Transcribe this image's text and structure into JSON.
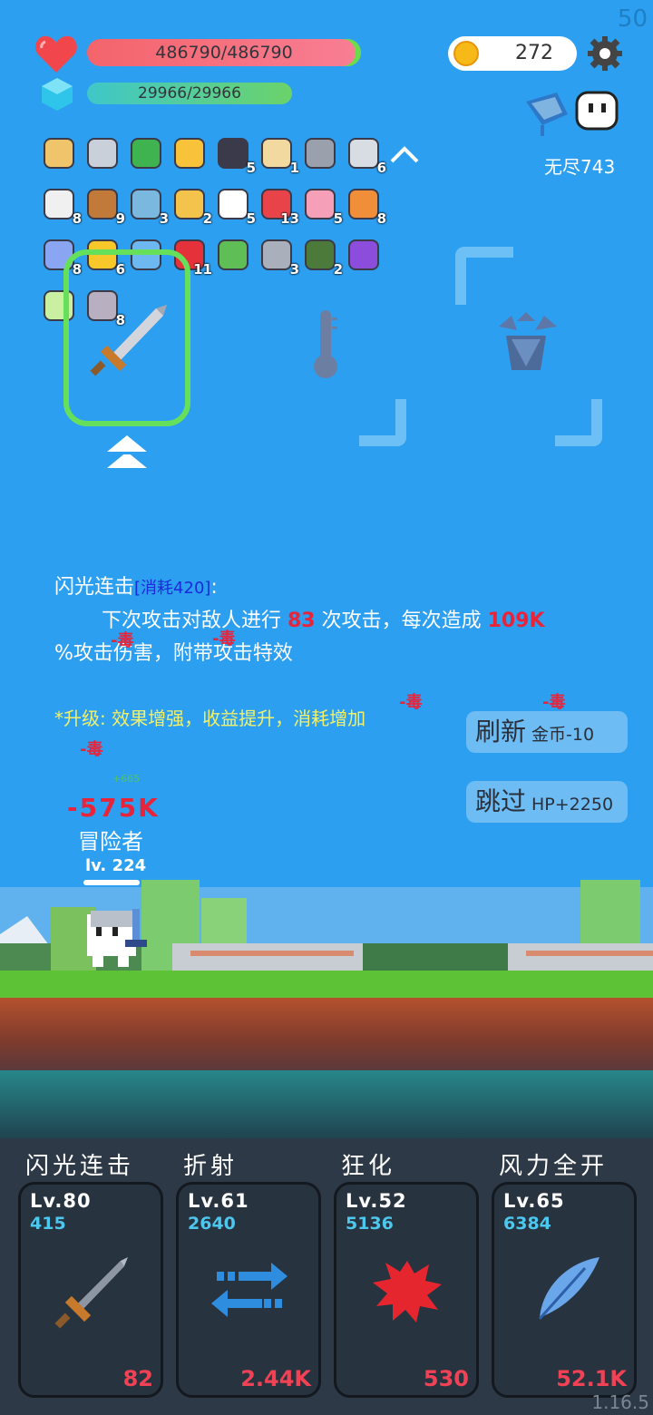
{
  "fps": "50",
  "hp": {
    "text": "486790/486790"
  },
  "mp": {
    "text": "29966/29966"
  },
  "gold": "272",
  "endless": "无尽743",
  "items": [
    {
      "icon": "scroll-icon",
      "count": ""
    },
    {
      "icon": "sword-icon",
      "count": ""
    },
    {
      "icon": "book-icon",
      "count": ""
    },
    {
      "icon": "sun-icon",
      "count": ""
    },
    {
      "icon": "bat-icon",
      "count": "5"
    },
    {
      "icon": "map-icon",
      "count": "1"
    },
    {
      "icon": "viking-helmet-icon",
      "count": ""
    },
    {
      "icon": "compass-icon",
      "count": "6"
    },
    {
      "icon": "cards-icon",
      "count": "8"
    },
    {
      "icon": "bow-icon",
      "count": "9"
    },
    {
      "icon": "target-icon",
      "count": "3"
    },
    {
      "icon": "ring-icon",
      "count": "2"
    },
    {
      "icon": "egg-icon",
      "count": "5"
    },
    {
      "icon": "pill-icon",
      "count": "13"
    },
    {
      "icon": "ice-cream-icon",
      "count": "5"
    },
    {
      "icon": "meteor-icon",
      "count": "8"
    },
    {
      "icon": "capsule-icon",
      "count": "8"
    },
    {
      "icon": "sunflower-icon",
      "count": "6"
    },
    {
      "icon": "card-star-icon",
      "count": ""
    },
    {
      "icon": "apple-icon",
      "count": "11"
    },
    {
      "icon": "slime-icon",
      "count": ""
    },
    {
      "icon": "axe-icon",
      "count": "3"
    },
    {
      "icon": "grenade-icon",
      "count": "2"
    },
    {
      "icon": "chest-icon",
      "count": ""
    },
    {
      "icon": "lamp-icon",
      "count": ""
    },
    {
      "icon": "mirror-icon",
      "count": "8"
    }
  ],
  "skill_desc": {
    "title": "闪光连击",
    "cost": "[消耗420]",
    "colon": ":",
    "line1a": "下次攻击对敌人进行 ",
    "hits": "83",
    "line1b": " 次攻击，每次造成 ",
    "dmg": "109K",
    "line2": "%攻击伤害，附带攻击特效",
    "upgrade": "*升级: 效果增强，收益提升，消耗增加"
  },
  "buttons": {
    "refresh": "刷新",
    "refresh_cost": "金币-10",
    "skip": "跳过",
    "skip_bonus": "HP+2250"
  },
  "floating": {
    "poison": "-毒",
    "heal": "+665",
    "damage": "-575K"
  },
  "hero": {
    "name": "冒险者",
    "level": "lv. 224"
  },
  "skills": [
    {
      "name": "闪光连击",
      "level": "Lv.80",
      "cost": "415",
      "value": "82",
      "icon": "sword-icon"
    },
    {
      "name": "折射",
      "level": "Lv.61",
      "cost": "2640",
      "value": "2.44K",
      "icon": "arrows-icon"
    },
    {
      "name": "狂化",
      "level": "Lv.52",
      "cost": "5136",
      "value": "530",
      "icon": "blood-splat-icon"
    },
    {
      "name": "风力全开",
      "level": "Lv.65",
      "cost": "6384",
      "value": "52.1K",
      "icon": "feather-icon"
    }
  ],
  "version": "1.16.5"
}
